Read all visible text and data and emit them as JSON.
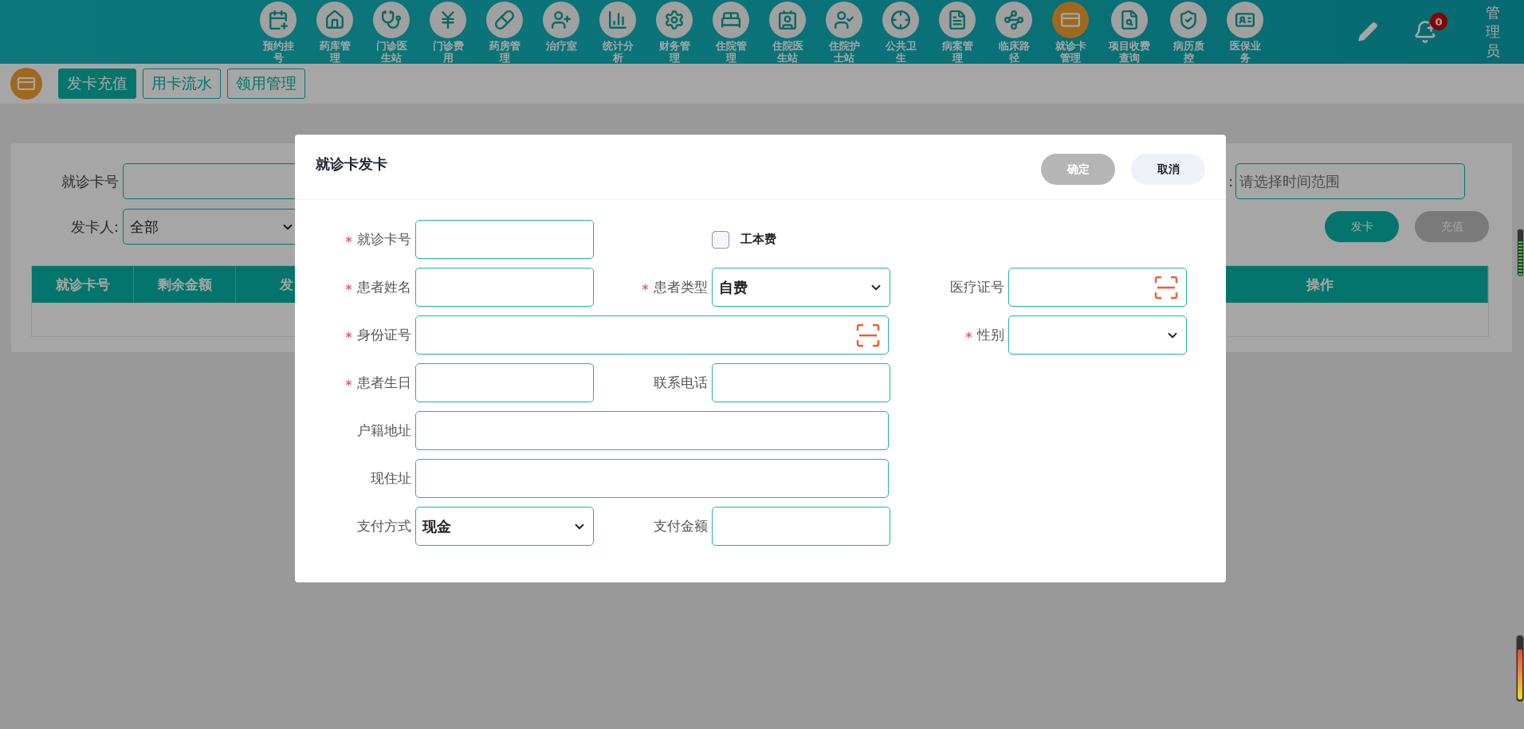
{
  "nav": {
    "items": [
      {
        "label": "预约挂号",
        "selected": false
      },
      {
        "label": "药库管理",
        "selected": false
      },
      {
        "label": "门诊医生站",
        "selected": false
      },
      {
        "label": "门诊费用",
        "selected": false
      },
      {
        "label": "药房管理",
        "selected": false
      },
      {
        "label": "治疗室",
        "selected": false
      },
      {
        "label": "统计分析",
        "selected": false
      },
      {
        "label": "财务管理",
        "selected": false
      },
      {
        "label": "住院管理",
        "selected": false
      },
      {
        "label": "住院医生站",
        "selected": false
      },
      {
        "label": "住院护士站",
        "selected": false
      },
      {
        "label": "公共卫生",
        "selected": false
      },
      {
        "label": "病案管理",
        "selected": false
      },
      {
        "label": "临床路径",
        "selected": false
      },
      {
        "label": "就诊卡管理",
        "selected": true
      },
      {
        "label": "项目收费查询",
        "selected": false
      },
      {
        "label": "病历质控",
        "selected": false
      },
      {
        "label": "医保业务",
        "selected": false
      }
    ],
    "badge": "0",
    "user": "管理员"
  },
  "tabs": [
    {
      "label": "发卡充值",
      "selected": true
    },
    {
      "label": "用卡流水",
      "selected": false
    },
    {
      "label": "领用管理",
      "selected": false
    }
  ],
  "filters": {
    "card_no": {
      "label": "就诊卡号"
    },
    "issuer": {
      "label": "发卡人:",
      "value": "全部"
    },
    "date": {
      "label": ":",
      "placeholder": "请选择时间范围"
    },
    "buttons": [
      {
        "label": "发卡",
        "kind": "primary"
      },
      {
        "label": "充值",
        "kind": "secondary"
      }
    ]
  },
  "table": {
    "columns": [
      "就诊卡号",
      "剩余金额",
      "发",
      "操作"
    ]
  },
  "dialog": {
    "title": "就诊卡发卡",
    "buttons": [
      {
        "label": "确定",
        "kind": "confirm"
      },
      {
        "label": "取消",
        "kind": "cancel"
      }
    ],
    "rows": [
      [
        {
          "kind": "text",
          "label": "就诊卡号",
          "required": true
        },
        {
          "kind": "checkbox",
          "label": "工本费",
          "checked": false
        }
      ],
      [
        {
          "kind": "text",
          "label": "患者姓名",
          "required": true
        },
        {
          "kind": "select",
          "label": "患者类型",
          "required": true,
          "value": "自费"
        },
        {
          "kind": "scan",
          "label": "医疗证号",
          "required": false
        }
      ],
      [
        {
          "kind": "scan",
          "label": "身份证号",
          "required": true
        },
        "",
        {
          "kind": "select",
          "label": "性别",
          "required": true
        }
      ],
      [
        {
          "kind": "text",
          "label": "患者生日",
          "required": true
        },
        {
          "kind": "text",
          "label": "联系电话",
          "required": false
        }
      ],
      [
        {
          "kind": "text",
          "label": "户籍地址",
          "required": false
        },
        ""
      ],
      [
        {
          "kind": "text",
          "label": "现住址",
          "required": false
        },
        ""
      ],
      [
        {
          "kind": "select",
          "label": "支付方式",
          "required": false,
          "value": "现金"
        },
        {
          "kind": "text",
          "label": "支付金额",
          "required": false
        }
      ]
    ]
  }
}
